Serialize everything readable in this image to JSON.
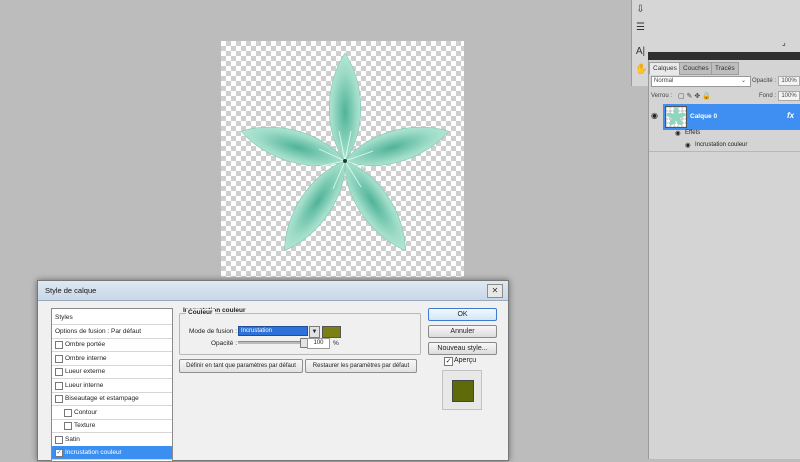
{
  "canvas": {
    "label": ""
  },
  "toolstrip": {
    "tools": [
      "tool-icon",
      "tool-icon",
      "text-tool-icon",
      "hand-icon"
    ],
    "glyphs": [
      "⇩",
      "☰",
      "A|",
      "✋"
    ]
  },
  "layers_panel": {
    "tabs": [
      "Calques",
      "Couches",
      "Tracés"
    ],
    "blend_mode": "Normal",
    "opacity_label": "Opacité :",
    "opacity_value": "100%",
    "lock_label": "Verrou :",
    "fill_label": "Fond :",
    "fill_value": "100%",
    "layer_name": "Calque 0",
    "fx_label": "fx",
    "effects_label": "Effets",
    "effect_item": "Incrustation couleur"
  },
  "dialog": {
    "title": "Style de calque",
    "close_glyph": "✕",
    "style_list": [
      {
        "label": "Styles",
        "checkbox": false,
        "checked": false,
        "indent": 0,
        "selected": false
      },
      {
        "label": "Options de fusion : Par défaut",
        "checkbox": false,
        "checked": false,
        "indent": 0,
        "selected": false
      },
      {
        "label": "Ombre portée",
        "checkbox": true,
        "checked": false,
        "indent": 0,
        "selected": false
      },
      {
        "label": "Ombre interne",
        "checkbox": true,
        "checked": false,
        "indent": 0,
        "selected": false
      },
      {
        "label": "Lueur externe",
        "checkbox": true,
        "checked": false,
        "indent": 0,
        "selected": false
      },
      {
        "label": "Lueur interne",
        "checkbox": true,
        "checked": false,
        "indent": 0,
        "selected": false
      },
      {
        "label": "Biseautage et estampage",
        "checkbox": true,
        "checked": false,
        "indent": 0,
        "selected": false
      },
      {
        "label": "Contour",
        "checkbox": true,
        "checked": false,
        "indent": 1,
        "selected": false
      },
      {
        "label": "Texture",
        "checkbox": true,
        "checked": false,
        "indent": 1,
        "selected": false
      },
      {
        "label": "Satin",
        "checkbox": true,
        "checked": false,
        "indent": 0,
        "selected": false
      },
      {
        "label": "Incrustation couleur",
        "checkbox": true,
        "checked": true,
        "indent": 0,
        "selected": true
      }
    ],
    "panel_title": "Incrustation couleur",
    "group_title": "Couleur",
    "blend_label": "Mode de fusion :",
    "blend_value": "Incrustation",
    "overlay_color": "#7a8011",
    "opacity_label": "Opacité :",
    "opacity_value": "100",
    "opacity_unit": "%",
    "opacity_fraction": 1.0,
    "set_default_button": "Définir en tant que paramètres par défaut",
    "reset_default_button": "Restaurer les paramètres par défaut",
    "ok_button": "OK",
    "cancel_button": "Annuler",
    "new_style_button": "Nouveau style...",
    "preview_label": "Aperçu",
    "preview_checked": true,
    "preview_color": "#5f6a0b"
  }
}
